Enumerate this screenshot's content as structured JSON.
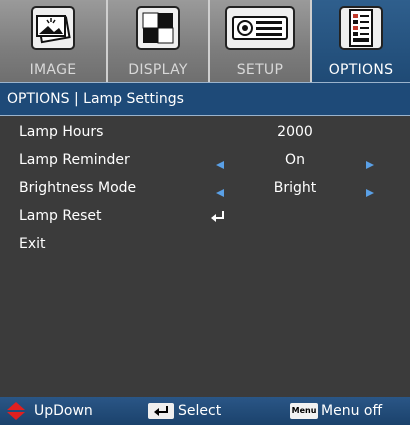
{
  "tabs": [
    {
      "label": "IMAGE",
      "icon": "image-icon",
      "active": false
    },
    {
      "label": "DISPLAY",
      "icon": "display-icon",
      "active": false
    },
    {
      "label": "SETUP",
      "icon": "projector-icon",
      "active": false
    },
    {
      "label": "OPTIONS",
      "icon": "options-icon",
      "active": true
    }
  ],
  "header": {
    "title": "OPTIONS | Lamp Settings"
  },
  "items": [
    {
      "label": "Lamp Hours",
      "value": "2000"
    },
    {
      "label": "Lamp Reminder",
      "value": "On"
    },
    {
      "label": "Brightness Mode",
      "value": "Bright"
    },
    {
      "label": "Lamp Reset"
    },
    {
      "label": "Exit"
    }
  ],
  "footer": {
    "updown_label": "UpDown",
    "select_label": "Select",
    "menu_key": "Menu",
    "menuoff_label": "Menu off"
  },
  "colors": {
    "accent": "#1e4a78",
    "background": "#3b3b3b",
    "tab_inactive": "#8a8a8a",
    "arrow": "#5aa0e6"
  }
}
